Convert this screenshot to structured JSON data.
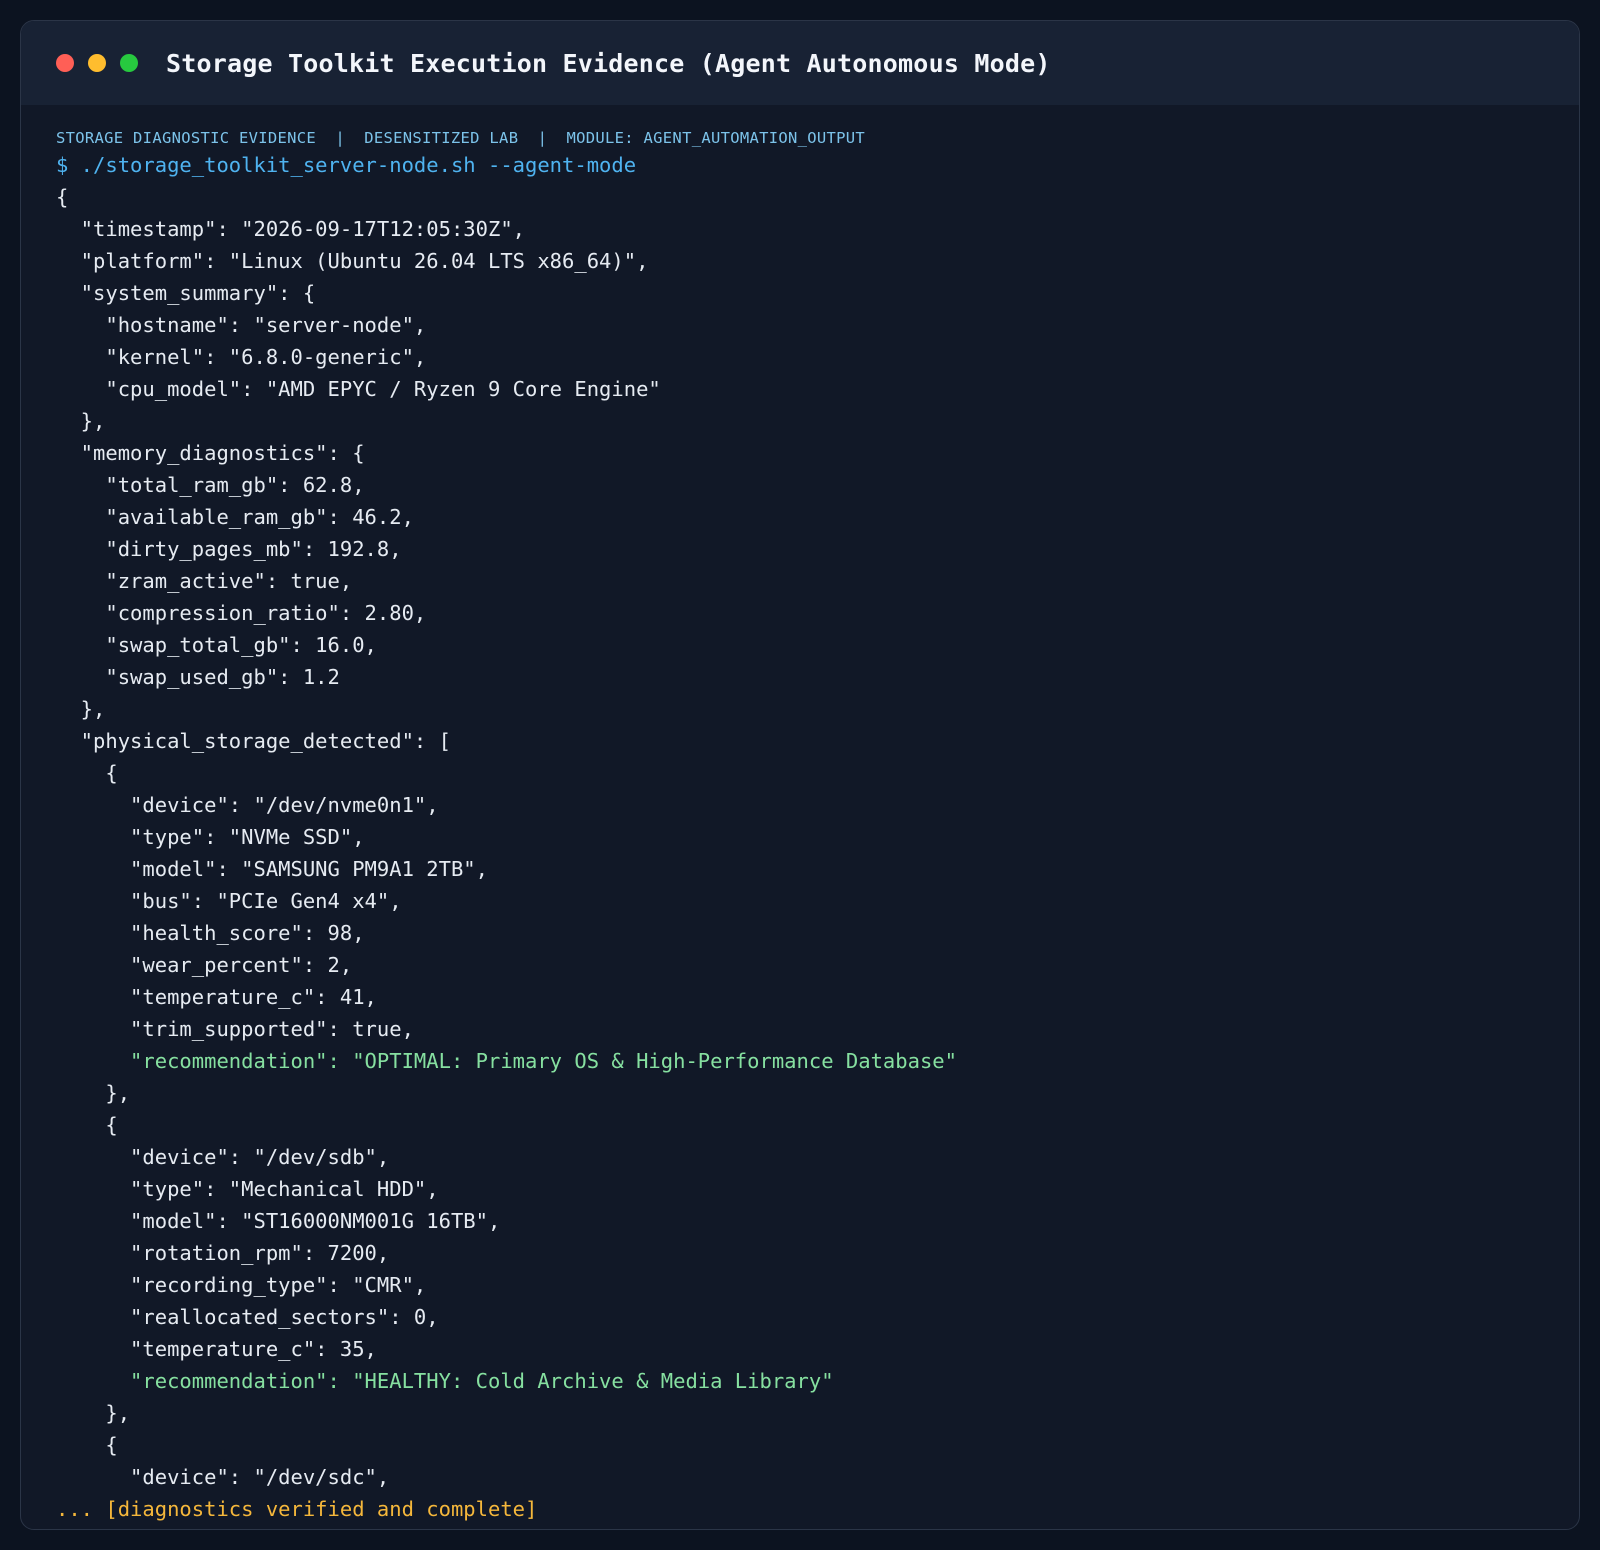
{
  "window": {
    "title": "Storage Toolkit Execution Evidence (Agent Autonomous Mode)",
    "controls": [
      {
        "name": "close",
        "color": "#ff5f56"
      },
      {
        "name": "minimize",
        "color": "#ffbd2e"
      },
      {
        "name": "maximize",
        "color": "#27c93f"
      }
    ]
  },
  "header": {
    "meta_line": "STORAGE DIAGNOSTIC EVIDENCE  |  DESENSITIZED LAB  |  MODULE: AGENT_AUTOMATION_OUTPUT"
  },
  "terminal": {
    "command": "$ ./storage_toolkit_server-node.sh --agent-mode",
    "lines": [
      {
        "text": "{",
        "style": "normal"
      },
      {
        "text": "  \"timestamp\": \"2026-09-17T12:05:30Z\",",
        "style": "normal"
      },
      {
        "text": "  \"platform\": \"Linux (Ubuntu 26.04 LTS x86_64)\",",
        "style": "normal"
      },
      {
        "text": "  \"system_summary\": {",
        "style": "normal"
      },
      {
        "text": "    \"hostname\": \"server-node\",",
        "style": "normal"
      },
      {
        "text": "    \"kernel\": \"6.8.0-generic\",",
        "style": "normal"
      },
      {
        "text": "    \"cpu_model\": \"AMD EPYC / Ryzen 9 Core Engine\"",
        "style": "normal"
      },
      {
        "text": "  },",
        "style": "normal"
      },
      {
        "text": "  \"memory_diagnostics\": {",
        "style": "normal"
      },
      {
        "text": "    \"total_ram_gb\": 62.8,",
        "style": "normal"
      },
      {
        "text": "    \"available_ram_gb\": 46.2,",
        "style": "normal"
      },
      {
        "text": "    \"dirty_pages_mb\": 192.8,",
        "style": "normal"
      },
      {
        "text": "    \"zram_active\": true,",
        "style": "normal"
      },
      {
        "text": "    \"compression_ratio\": 2.80,",
        "style": "normal"
      },
      {
        "text": "    \"swap_total_gb\": 16.0,",
        "style": "normal"
      },
      {
        "text": "    \"swap_used_gb\": 1.2",
        "style": "normal"
      },
      {
        "text": "  },",
        "style": "normal"
      },
      {
        "text": "  \"physical_storage_detected\": [",
        "style": "normal"
      },
      {
        "text": "    {",
        "style": "normal"
      },
      {
        "text": "      \"device\": \"/dev/nvme0n1\",",
        "style": "normal"
      },
      {
        "text": "      \"type\": \"NVMe SSD\",",
        "style": "normal"
      },
      {
        "text": "      \"model\": \"SAMSUNG PM9A1 2TB\",",
        "style": "normal"
      },
      {
        "text": "      \"bus\": \"PCIe Gen4 x4\",",
        "style": "normal"
      },
      {
        "text": "      \"health_score\": 98,",
        "style": "normal"
      },
      {
        "text": "      \"wear_percent\": 2,",
        "style": "normal"
      },
      {
        "text": "      \"temperature_c\": 41,",
        "style": "normal"
      },
      {
        "text": "      \"trim_supported\": true,",
        "style": "normal"
      },
      {
        "text": "      \"recommendation\": \"OPTIMAL: Primary OS & High-Performance Database\"",
        "style": "highlight"
      },
      {
        "text": "    },",
        "style": "normal"
      },
      {
        "text": "    {",
        "style": "normal"
      },
      {
        "text": "      \"device\": \"/dev/sdb\",",
        "style": "normal"
      },
      {
        "text": "      \"type\": \"Mechanical HDD\",",
        "style": "normal"
      },
      {
        "text": "      \"model\": \"ST16000NM001G 16TB\",",
        "style": "normal"
      },
      {
        "text": "      \"rotation_rpm\": 7200,",
        "style": "normal"
      },
      {
        "text": "      \"recording_type\": \"CMR\",",
        "style": "normal"
      },
      {
        "text": "      \"reallocated_sectors\": 0,",
        "style": "normal"
      },
      {
        "text": "      \"temperature_c\": 35,",
        "style": "normal"
      },
      {
        "text": "      \"recommendation\": \"HEALTHY: Cold Archive & Media Library\"",
        "style": "highlight"
      },
      {
        "text": "    },",
        "style": "normal"
      },
      {
        "text": "    {",
        "style": "normal"
      },
      {
        "text": "      \"device\": \"/dev/sdc\",",
        "style": "normal"
      }
    ],
    "footer": "... [diagnostics verified and complete]"
  }
}
